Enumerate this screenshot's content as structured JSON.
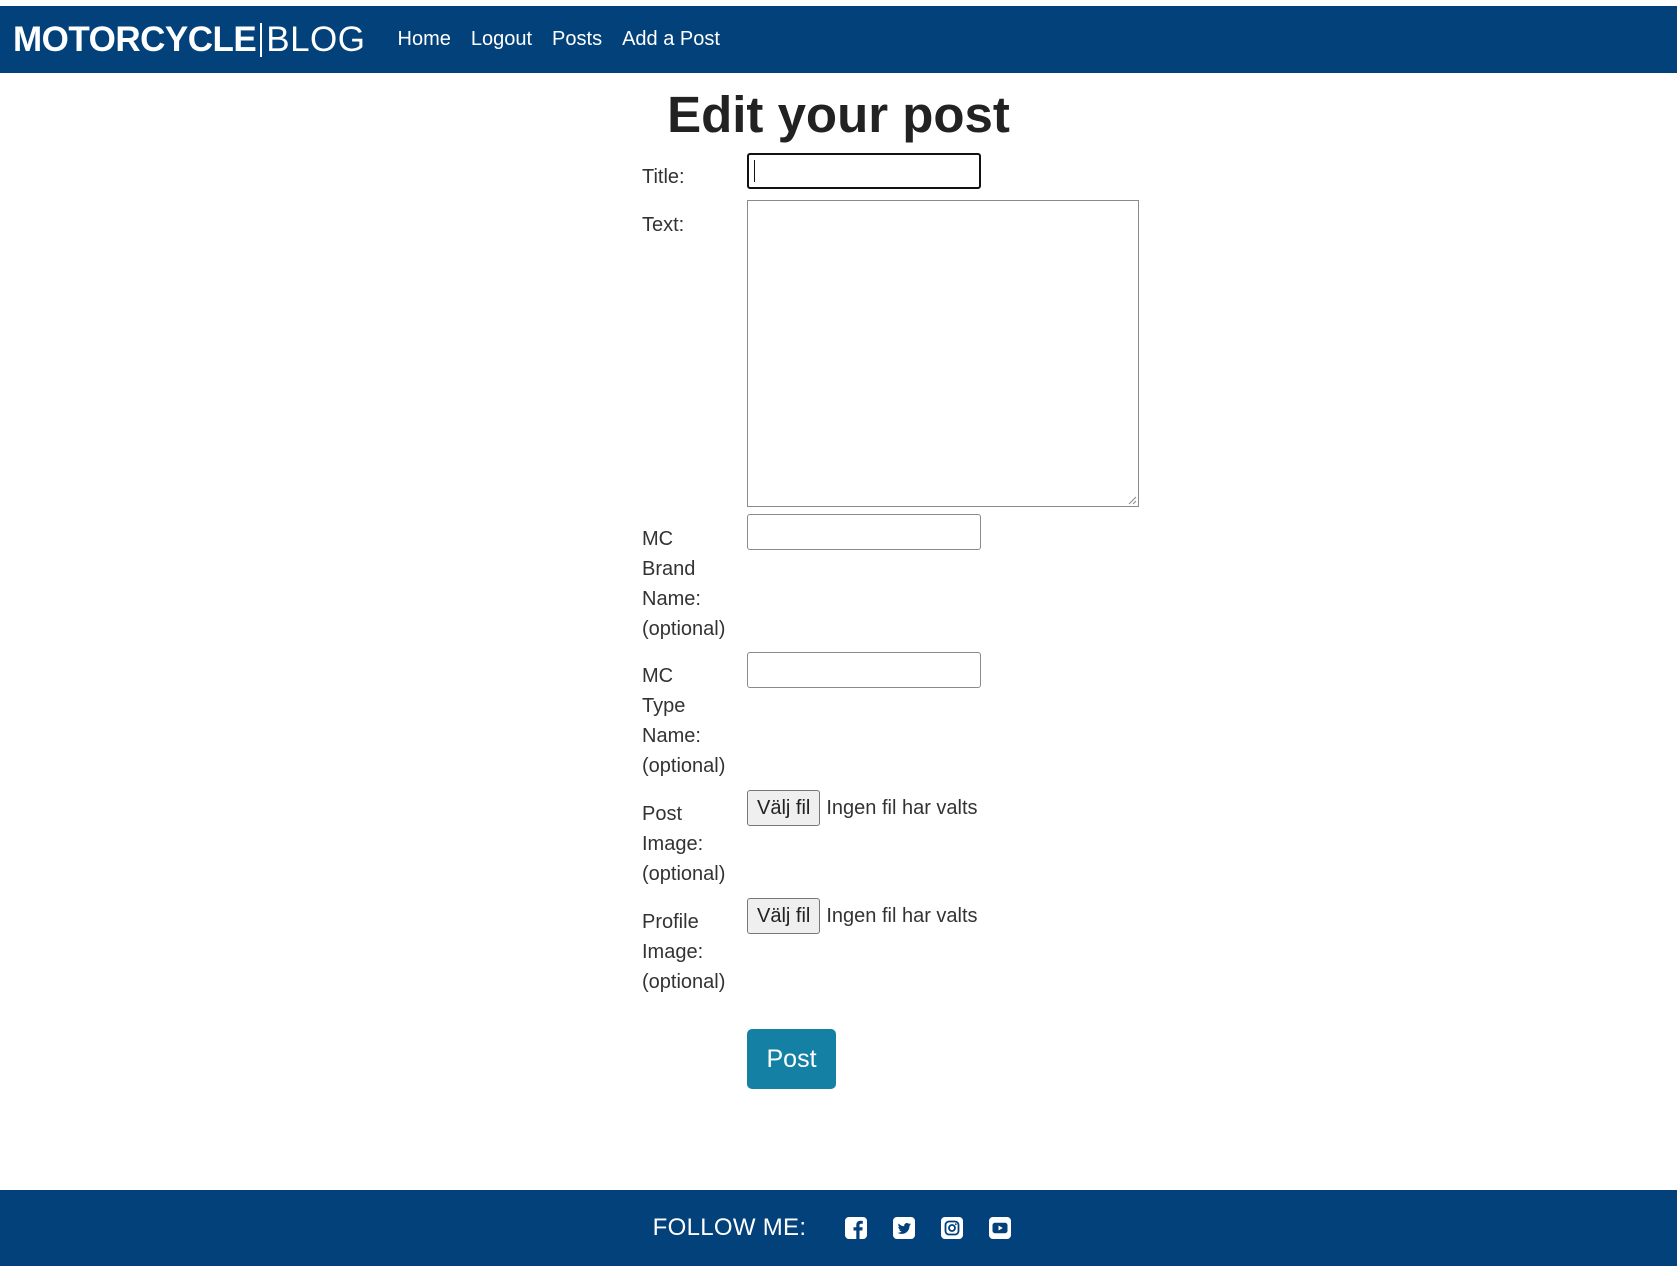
{
  "brand": {
    "bold": "MOTORCYCLE",
    "light": "BLOG"
  },
  "nav": {
    "items": [
      {
        "label": "Home"
      },
      {
        "label": "Logout"
      },
      {
        "label": "Posts"
      },
      {
        "label": "Add a Post"
      }
    ]
  },
  "page": {
    "title": "Edit your post"
  },
  "form": {
    "title_label": "Title:",
    "text_label": "Text:",
    "brand_label": [
      "MC",
      "Brand",
      "Name:",
      "(optional)"
    ],
    "type_label": [
      "MC",
      "Type",
      "Name:",
      "(optional)"
    ],
    "post_image_label": [
      "Post",
      "Image:",
      "(optional)"
    ],
    "profile_image_label": [
      "Profile",
      "Image:",
      "(optional)"
    ],
    "file_button": "Välj fil",
    "file_status": "Ingen fil har valts",
    "submit": "Post"
  },
  "footer": {
    "follow": "FOLLOW ME:",
    "icons": [
      "facebook-icon",
      "twitter-icon",
      "instagram-icon",
      "youtube-icon"
    ]
  },
  "colors": {
    "primary": "#03417a",
    "button": "#1481a4"
  }
}
